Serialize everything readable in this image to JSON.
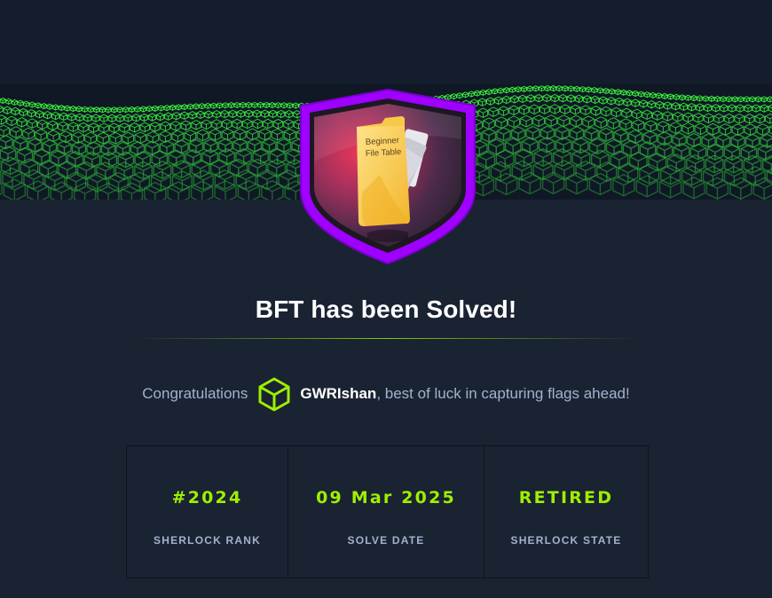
{
  "badge": {
    "label_line1": "Beginner",
    "label_line2": "File Table"
  },
  "header": {
    "title": "BFT has been Solved!"
  },
  "congrats": {
    "prefix": "Congratulations",
    "username": "GWRIshan",
    "suffix": ", best of luck in capturing flags ahead!",
    "icon": "hackthebox-cube-icon"
  },
  "stats": [
    {
      "value": "#2024",
      "label": "SHERLOCK RANK"
    },
    {
      "value": "09 Mar 2025",
      "label": "SOLVE DATE"
    },
    {
      "value": "RETIRED",
      "label": "SHERLOCK STATE"
    }
  ],
  "colors": {
    "accent": "#9fef00",
    "background": "#1a2332",
    "shield_border": "#9f00ff",
    "text_muted": "#a4b1cd"
  }
}
